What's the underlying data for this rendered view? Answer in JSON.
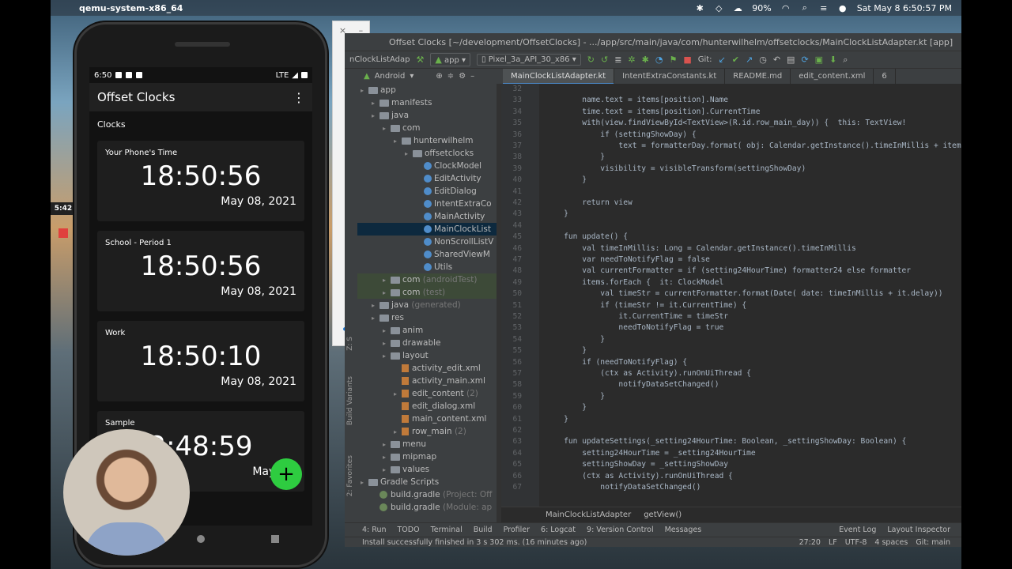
{
  "menubar": {
    "app_name": "qemu-system-x86_64",
    "battery": "90%",
    "datetime": "Sat May 8  6:50:57 PM"
  },
  "phone": {
    "status_time": "6:50",
    "network": "LTE",
    "app_title": "Offset Clocks",
    "section_label": "Clocks",
    "clocks": [
      {
        "name": "Your Phone's Time",
        "time": "18:50:56",
        "date": "May 08, 2021"
      },
      {
        "name": "School - Period 1",
        "time": "18:50:56",
        "date": "May 08, 2021"
      },
      {
        "name": "Work",
        "time": "18:50:10",
        "date": "May 08, 2021"
      },
      {
        "name": "Sample",
        "time": "2:48:59",
        "date": "May 08,"
      }
    ],
    "fab_label": "+"
  },
  "recording": {
    "timer": "5:42"
  },
  "emulator": {
    "close": "×",
    "minimize": "–"
  },
  "ide": {
    "window_title": "Offset Clocks [~/development/OffsetClocks] - .../app/src/main/java/com/hunterwilhelm/offsetclocks/MainClockListAdapter.kt [app]",
    "toolbar": {
      "run_config": "nClockListAdap",
      "module": "app",
      "device": "Pixel_3a_API_30_x86",
      "git_label": "Git:"
    },
    "project_view": "Android",
    "tabs": [
      "MainClockListAdapter.kt",
      "IntentExtraConstants.kt",
      "README.md",
      "edit_content.xml",
      "6"
    ],
    "side_labels": {
      "build_variants": "Build Variants",
      "favorites": "2: Favorites",
      "structure": "Z: S"
    },
    "tree": [
      {
        "label": "app",
        "indent": 0
      },
      {
        "label": "manifests",
        "indent": 1
      },
      {
        "label": "java",
        "indent": 1
      },
      {
        "label": "com",
        "indent": 2
      },
      {
        "label": "hunterwilhelm",
        "indent": 3
      },
      {
        "label": "offsetclocks",
        "indent": 4
      },
      {
        "label": "ClockModel",
        "indent": 5
      },
      {
        "label": "EditActivity",
        "indent": 5
      },
      {
        "label": "EditDialog",
        "indent": 5
      },
      {
        "label": "IntentExtraCo",
        "indent": 5
      },
      {
        "label": "MainActivity",
        "indent": 5
      },
      {
        "label": "MainClockList",
        "indent": 5
      },
      {
        "label": "NonScrollListV",
        "indent": 5
      },
      {
        "label": "SharedViewM",
        "indent": 5
      },
      {
        "label": "Utils",
        "indent": 5
      },
      {
        "label": "com",
        "suffix": "(androidTest)",
        "indent": 2
      },
      {
        "label": "com",
        "suffix": "(test)",
        "indent": 2
      },
      {
        "label": "java",
        "suffix": "(generated)",
        "indent": 1
      },
      {
        "label": "res",
        "indent": 1
      },
      {
        "label": "anim",
        "indent": 2
      },
      {
        "label": "drawable",
        "indent": 2
      },
      {
        "label": "layout",
        "indent": 2
      },
      {
        "label": "activity_edit.xml",
        "indent": 3
      },
      {
        "label": "activity_main.xml",
        "indent": 3
      },
      {
        "label": "edit_content",
        "suffix": "(2)",
        "indent": 3
      },
      {
        "label": "edit_dialog.xml",
        "indent": 3
      },
      {
        "label": "main_content.xml",
        "indent": 3
      },
      {
        "label": "row_main",
        "suffix": "(2)",
        "indent": 3
      },
      {
        "label": "menu",
        "indent": 2
      },
      {
        "label": "mipmap",
        "indent": 2
      },
      {
        "label": "values",
        "indent": 2
      },
      {
        "label": "Gradle Scripts",
        "indent": 0
      },
      {
        "label": "build.gradle",
        "suffix": "(Project: Off",
        "indent": 1
      },
      {
        "label": "build.gradle",
        "suffix": "(Module: ap",
        "indent": 1
      }
    ],
    "code_lines": [
      {
        "n": "32",
        "t": ""
      },
      {
        "n": "33",
        "t": "        name.text = items[position].Name"
      },
      {
        "n": "34",
        "t": "        time.text = items[position].CurrentTime"
      },
      {
        "n": "35",
        "t": "        with(view.findViewById<TextView>(R.id.row_main_day)) {  this: TextView!"
      },
      {
        "n": "36",
        "t": "            if (settingShowDay) {"
      },
      {
        "n": "37",
        "t": "                text = formatterDay.format( obj: Calendar.getInstance().timeInMillis + items[po"
      },
      {
        "n": "38",
        "t": "            }"
      },
      {
        "n": "39",
        "t": "            visibility = visibleTransform(settingShowDay)"
      },
      {
        "n": "40",
        "t": "        }"
      },
      {
        "n": "41",
        "t": ""
      },
      {
        "n": "42",
        "t": "        return view"
      },
      {
        "n": "43",
        "t": "    }"
      },
      {
        "n": "44",
        "t": ""
      },
      {
        "n": "45",
        "t": "    fun update() {"
      },
      {
        "n": "46",
        "t": "        val timeInMillis: Long = Calendar.getInstance().timeInMillis"
      },
      {
        "n": "47",
        "t": "        var needToNotifyFlag = false"
      },
      {
        "n": "48",
        "t": "        val currentFormatter = if (setting24HourTime) formatter24 else formatter"
      },
      {
        "n": "49",
        "t": "        items.forEach {  it: ClockModel"
      },
      {
        "n": "50",
        "t": "            val timeStr = currentFormatter.format(Date( date: timeInMillis + it.delay))"
      },
      {
        "n": "51",
        "t": "            if (timeStr != it.CurrentTime) {"
      },
      {
        "n": "52",
        "t": "                it.CurrentTime = timeStr"
      },
      {
        "n": "53",
        "t": "                needToNotifyFlag = true"
      },
      {
        "n": "54",
        "t": "            }"
      },
      {
        "n": "55",
        "t": "        }"
      },
      {
        "n": "56",
        "t": "        if (needToNotifyFlag) {"
      },
      {
        "n": "57",
        "t": "            (ctx as Activity).runOnUiThread {"
      },
      {
        "n": "58",
        "t": "                notifyDataSetChanged()"
      },
      {
        "n": "59",
        "t": "            }"
      },
      {
        "n": "60",
        "t": "        }"
      },
      {
        "n": "61",
        "t": "    }"
      },
      {
        "n": "62",
        "t": ""
      },
      {
        "n": "63",
        "t": "    fun updateSettings(_setting24HourTime: Boolean, _settingShowDay: Boolean) {"
      },
      {
        "n": "64",
        "t": "        setting24HourTime = _setting24HourTime"
      },
      {
        "n": "65",
        "t": "        settingShowDay = _settingShowDay"
      },
      {
        "n": "66",
        "t": "        (ctx as Activity).runOnUiThread {"
      },
      {
        "n": "67",
        "t": "            notifyDataSetChanged()"
      }
    ],
    "breadcrumb": [
      "MainClockListAdapter",
      "getView()"
    ],
    "bottom_tools": [
      "4: Run",
      "TODO",
      "Terminal",
      "Build",
      "Profiler",
      "6: Logcat",
      "9: Version Control",
      "Messages"
    ],
    "bottom_tools_right": [
      "Event Log",
      "Layout Inspector"
    ],
    "status": {
      "message": "Install successfully finished in 3 s 302 ms. (16 minutes ago)",
      "position": "27:20",
      "line_sep": "LF",
      "encoding": "UTF-8",
      "indent": "4 spaces",
      "branch": "Git: main"
    }
  }
}
